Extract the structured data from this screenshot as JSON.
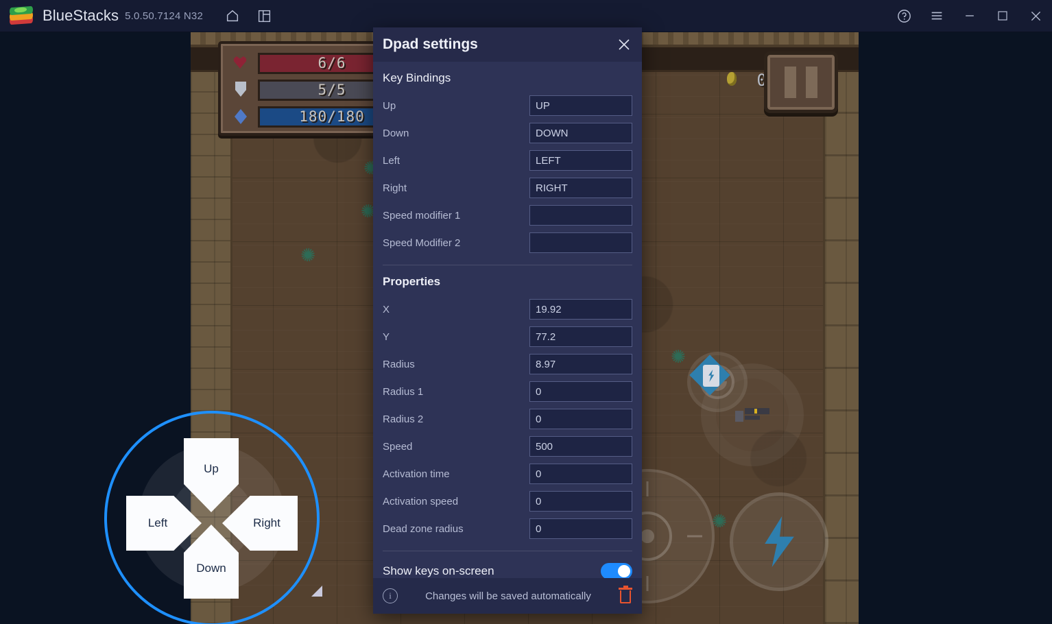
{
  "titlebar": {
    "app_name": "BlueStacks",
    "version": "5.0.50.7124 N32",
    "logo_icon": "bluestacks-logo-icon",
    "home_icon": "home-icon",
    "multi_instance_icon": "multi-instance-icon",
    "help_icon": "help-icon",
    "menu_icon": "hamburger-menu-icon",
    "minimize_icon": "minimize-icon",
    "maximize_icon": "maximize-icon",
    "close_icon": "close-icon"
  },
  "game": {
    "hud": {
      "health": "6/6",
      "shield": "5/5",
      "mana": "180/180",
      "health_icon": "heart-icon",
      "shield_icon": "shield-icon",
      "mana_icon": "gem-icon"
    },
    "coin_count": "0",
    "pause_icon": "pause-icon",
    "emote_icon": "smiley-face-icon",
    "reticle_icon": "targeting-reticle-icon",
    "dash_icon": "lightning-bolt-icon",
    "swap_weapon_icon": "weapon-swap-icon",
    "resize_handle_icon": "resize-handle-icon"
  },
  "dpad_overlay": {
    "up": "Up",
    "down": "Down",
    "left": "Left",
    "right": "Right"
  },
  "dialog": {
    "title": "Dpad settings",
    "close_icon": "close-icon",
    "sections": {
      "key_bindings": {
        "title": "Key Bindings",
        "fields": [
          {
            "label": "Up",
            "value": "UP"
          },
          {
            "label": "Down",
            "value": "DOWN"
          },
          {
            "label": "Left",
            "value": "LEFT"
          },
          {
            "label": "Right",
            "value": "RIGHT"
          },
          {
            "label": "Speed modifier 1",
            "value": ""
          },
          {
            "label": "Speed Modifier 2",
            "value": ""
          }
        ]
      },
      "properties": {
        "title": "Properties",
        "fields": [
          {
            "label": "X",
            "value": "19.92"
          },
          {
            "label": "Y",
            "value": "77.2"
          },
          {
            "label": "Radius",
            "value": "8.97"
          },
          {
            "label": "Radius 1",
            "value": "0"
          },
          {
            "label": "Radius 2",
            "value": "0"
          },
          {
            "label": "Speed",
            "value": "500"
          },
          {
            "label": "Activation time",
            "value": "0"
          },
          {
            "label": "Activation speed",
            "value": "0"
          },
          {
            "label": "Dead zone radius",
            "value": "0"
          }
        ]
      }
    },
    "show_keys": {
      "label": "Show keys on-screen",
      "enabled": true
    },
    "footer": {
      "info_icon": "info-icon",
      "message": "Changes will be saved automatically",
      "delete_icon": "trash-icon"
    }
  },
  "colors": {
    "titlebar_bg": "#151b32",
    "dialog_bg": "#2e3356",
    "dialog_header_bg": "#262a4a",
    "input_bg": "#1e2444",
    "accent_blue": "#1e8bff",
    "dpad_ring": "#1e90ff",
    "delete_red": "#e8542f",
    "letterbox": "#0a1322"
  }
}
